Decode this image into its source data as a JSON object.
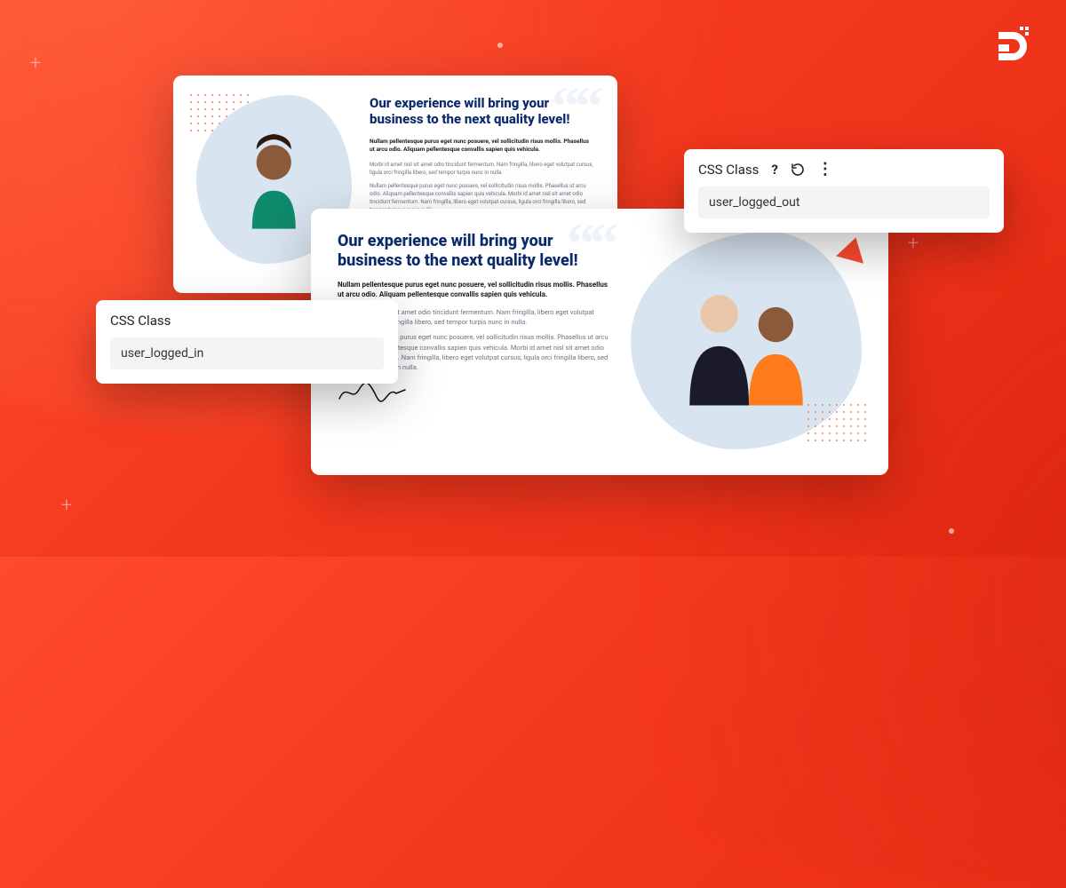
{
  "brand": {
    "logo_letter": "D"
  },
  "testimonial": {
    "headline": "Our experience will bring your business to the next quality level!",
    "lead": "Nullam pellentesque purus eget nunc posuere, vel sollicitudin risus mollis. Phasellus ut arcu odio. Aliquam pellentesque convallis sapien quis vehicula.",
    "para1": "Morbi id amet nisl sit amet odio tincidunt fermentum. Nam fringilla, libero eget volutpat cursus, ligula orci fringilla libero, sed tempor turpis nunc in nulla.",
    "para2": "Nullam pellentesque purus eget nunc posuere, vel sollicitudin risus mollis. Phasellus ut arcu odio. Aliquam pellentesque convallis sapien quis vehicula. Morbi id amet nisl sit amet odio tincidunt fermentum. Nam fringilla, libero eget volutpat cursus, ligula orci fringilla libero, sed tempor turpis nunc in nulla.",
    "signature": "Signature"
  },
  "panel_left": {
    "label": "CSS Class",
    "value": "user_logged_in"
  },
  "panel_right": {
    "label": "CSS Class",
    "value": "user_logged_out",
    "help_icon": "?",
    "reset_icon": "↺",
    "more_icon": "⋮"
  }
}
